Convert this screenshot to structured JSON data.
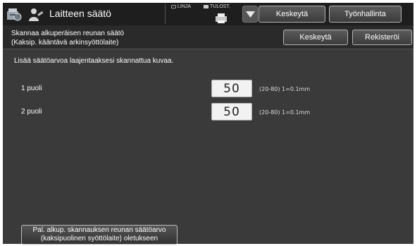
{
  "header": {
    "title": "Laitteen säätö",
    "indicator_line": "LINJA",
    "indicator_print": "TULOST.",
    "cancel_label": "Keskeytä",
    "job_status_label": "Työnhallinta"
  },
  "subheader": {
    "line1": "Skannaa alkuperäisen reunan säätö",
    "line2": "(Kaksip. kääntävä arkinsyöttölaite)",
    "cancel_label": "Keskeytä",
    "register_label": "Rekisteröi"
  },
  "main": {
    "instruction": "Lisää säätöarvoa laajentaaksesi skannattua kuvaa.",
    "rows": [
      {
        "label": "1 puoli",
        "value": "50",
        "range": "(20-80) 1=0.1mm"
      },
      {
        "label": "2 puoli",
        "value": "50",
        "range": "(20-80) 1=0.1mm"
      }
    ]
  },
  "footer": {
    "default_line1": "Pal. alkup. skannauksen reunan säätöarvo",
    "default_line2": "(kaksipuolinen syöttölaite) oletukseen"
  }
}
